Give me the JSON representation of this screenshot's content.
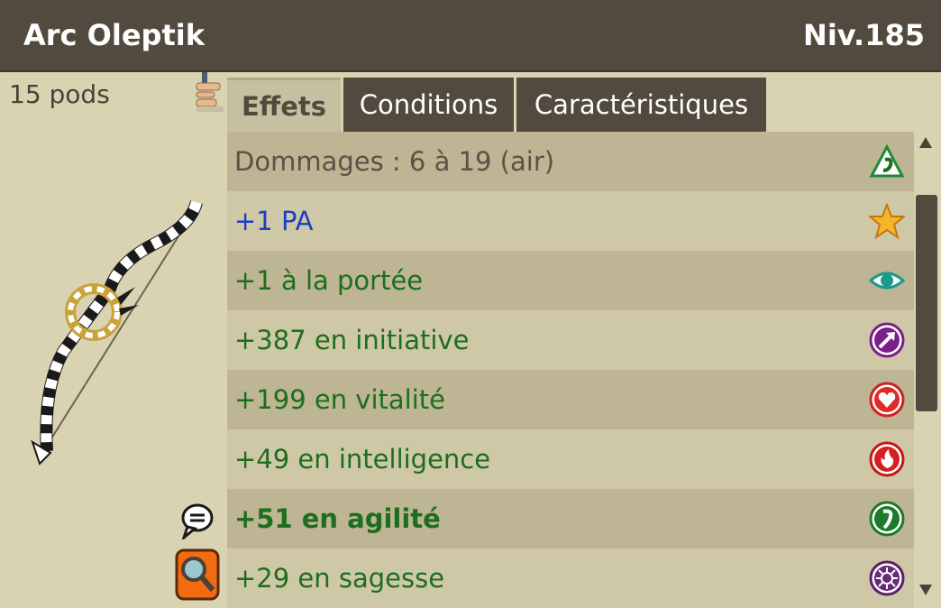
{
  "item": {
    "name": "Arc Oleptik",
    "level": "Niv.185",
    "weight": "15 pods"
  },
  "tabs": [
    {
      "label": "Effets",
      "active": true
    },
    {
      "label": "Conditions",
      "active": false
    },
    {
      "label": "Caractéristiques",
      "active": false
    }
  ],
  "effects": [
    {
      "text": "Dommages : 6 à 19 (air)",
      "color": "#5a5246",
      "bold": false,
      "icon": "air-damage-icon"
    },
    {
      "text": "+1 PA",
      "color": "#1b3fc4",
      "bold": false,
      "icon": "star-icon"
    },
    {
      "text": "+1 à la portée",
      "color": "#1d6e1d",
      "bold": false,
      "icon": "eye-icon"
    },
    {
      "text": "+387 en initiative",
      "color": "#1d6e1d",
      "bold": false,
      "icon": "initiative-arrow-icon"
    },
    {
      "text": "+199 en vitalité",
      "color": "#1d6e1d",
      "bold": false,
      "icon": "heart-icon"
    },
    {
      "text": "+49 en intelligence",
      "color": "#1d6e1d",
      "bold": false,
      "icon": "fire-icon"
    },
    {
      "text": "+51 en agilité",
      "color": "#1d6e1d",
      "bold": true,
      "icon": "agility-icon"
    },
    {
      "text": "+29 en sagesse",
      "color": "#1d6e1d",
      "bold": false,
      "icon": "wisdom-icon"
    }
  ],
  "colors": {
    "header": "#524a3e",
    "panel": "#d9d3b2",
    "row_dark": "#bdb593",
    "row_light": "#cfc8a7",
    "bonus_text": "#1d6e1d",
    "ap_text": "#1b3fc4"
  }
}
